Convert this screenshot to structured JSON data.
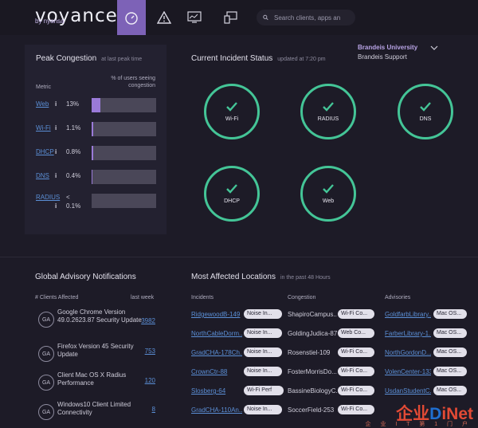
{
  "header": {
    "logo": "voyance",
    "logo_sub": "by nyansa",
    "search_placeholder": "Search clients, apps an"
  },
  "user": {
    "org": "Brandeis University",
    "name": "Brandeis Support"
  },
  "peak": {
    "title": "Peak Congestion",
    "subtitle": "at last peak time",
    "metric_header": "Metric",
    "pct_header_1": "% of users seeing",
    "pct_header_2": "congestion",
    "rows": [
      {
        "metric": "Web",
        "pct": "13%",
        "fill": 0.13
      },
      {
        "metric": "Wi-Fi",
        "pct": "1.1%",
        "fill": 0.011
      },
      {
        "metric": "DHCP",
        "pct": "0.8%",
        "fill": 0.008
      },
      {
        "metric": "DNS",
        "pct": "0.4%",
        "fill": 0.004
      },
      {
        "metric": "RADIUS",
        "pct_prefix": "<",
        "pct": "0.1%",
        "fill": 0.001
      }
    ]
  },
  "incident": {
    "title": "Current Incident Status",
    "subtitle": "updated at 7:20 pm",
    "items": [
      "Wi-Fi",
      "RADIUS",
      "DNS",
      "DHCP",
      "Web"
    ],
    "color": "#44c597"
  },
  "advisory": {
    "title": "Global Advisory Notifications",
    "col_clients": "# Clients Affected",
    "col_week": "last week",
    "rows": [
      {
        "initials": "GA",
        "text": "Google Chrome Version 49.0.2623.87 Security Update",
        "count": "3982"
      },
      {
        "initials": "GA",
        "text": "Firefox Version 45 Security Update",
        "count": "753"
      },
      {
        "initials": "GA",
        "text": "Client Mac OS X Radius Performance",
        "count": "120"
      },
      {
        "initials": "GA",
        "text": "Windows10 Client Limited Connectivity",
        "count": "8"
      }
    ]
  },
  "locations": {
    "title": "Most Affected Locations",
    "subtitle": "in the past 48 Hours",
    "col_incidents": "Incidents",
    "col_congestion": "Congestion",
    "col_advisories": "Advisories",
    "rows": [
      {
        "incident": "RidgewoodB-149",
        "incident_tag": "Noise In...",
        "congestion": "ShapiroCampus...",
        "congestion_tag": "Wi-Fi Co...",
        "advisory": "GoldfarbLibrary...",
        "advisory_tag": "Mac OS..."
      },
      {
        "incident": "NorthCableDorm...",
        "incident_tag": "Noise In...",
        "congestion": "GoldingJudica-87",
        "congestion_tag": "Web Co...",
        "advisory": "FarberLibrary-1...",
        "advisory_tag": "Mac OS..."
      },
      {
        "incident": "GradCHA-178Ch...",
        "incident_tag": "Noise In...",
        "congestion": "Rosenstiel-109",
        "congestion_tag": "Wi-Fi Co...",
        "advisory": "NorthGordonD...",
        "advisory_tag": "Mac OS..."
      },
      {
        "incident": "CrownCtr-88",
        "incident_tag": "Noise In...",
        "congestion": "FosterMorrisDo...",
        "congestion_tag": "Wi-Fi Co...",
        "advisory": "VolenCenter-133",
        "advisory_tag": "Mac OS..."
      },
      {
        "incident": "Slosberg-64",
        "incident_tag": "Wi-Fi Perf",
        "congestion": "BassineBiologyC...",
        "congestion_tag": "Wi-Fi Co...",
        "advisory": "UsdanStudentC...",
        "advisory_tag": "Mac OS..."
      },
      {
        "incident": "GradCHA-110An...",
        "incident_tag": "Noise In...",
        "congestion": "SoccerField-253",
        "congestion_tag": "Wi-Fi Co...",
        "advisory": "",
        "advisory_tag": ""
      }
    ]
  },
  "watermark": {
    "part1": "企业",
    "part2": "D",
    "part3": "iNet",
    "sub": "企 业 I T 第 1 门 户"
  }
}
